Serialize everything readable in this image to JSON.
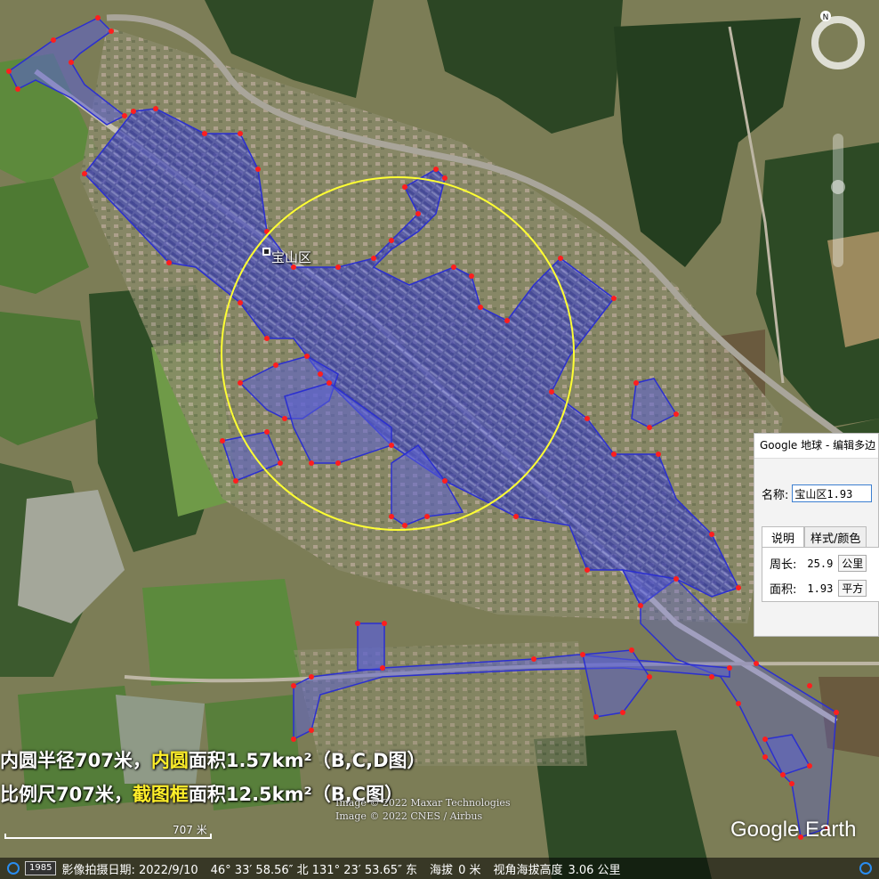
{
  "map": {
    "place_label": "宝山区",
    "circle_color": "#ffff33",
    "polygon_fill": "#5a5fd6",
    "polygon_stroke": "#2b2fd0",
    "vertex_color": "#ff1e1e"
  },
  "overlay": {
    "line1_a": "内圆半径707米，",
    "line1_hl": "内圆",
    "line1_b": "面积1.57km²（B,C,D图）",
    "line2_a": "比例尺707米，",
    "line2_hl": "截图框",
    "line2_b": "面积12.5km²（B,C图）",
    "highlight_color": "#ffef2a"
  },
  "attribution": {
    "line1": "Image © 2022 Maxar Technologies",
    "line2": "Image © 2022 CNES / Airbus"
  },
  "scale": {
    "label": "707 米"
  },
  "brand": "Google Earth",
  "compass": {
    "north_label": "N"
  },
  "statusbar": {
    "year": "1985",
    "date": "影像拍摄日期: 2022/9/10",
    "coords": "46° 33′ 58.56″ 北 131° 23′ 53.65″ 东",
    "elevation_label": "海拔",
    "elevation": "0 米",
    "eye_label": "视角海拔高度",
    "eye_alt": "3.06 公里"
  },
  "dialog": {
    "title": "Google 地球 - 编辑多边",
    "name_label": "名称:",
    "name_value": "宝山区1.93",
    "tab_desc": "说明",
    "tab_style": "样式/颜色",
    "perimeter_label": "周长:",
    "perimeter_value": "25.9",
    "perimeter_unit": "公里",
    "area_label": "面积:",
    "area_value": "1.93",
    "area_unit": "平方"
  }
}
